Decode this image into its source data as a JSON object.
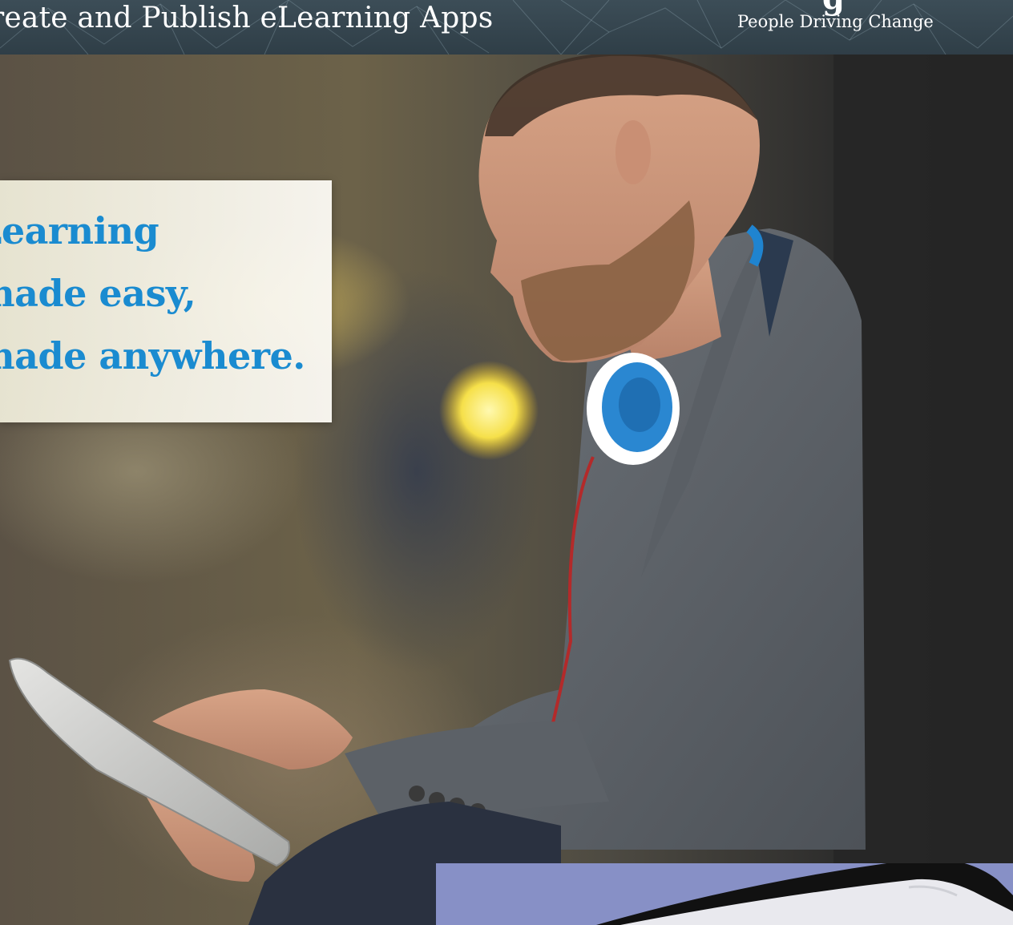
{
  "banner": {
    "title": "reate and Publish eLearning Apps",
    "brand_tagline": "People Driving Change",
    "brand_cut_glyph": "g"
  },
  "headline": {
    "line1": "Learning",
    "line2": "made easy,",
    "line3": "made anywhere."
  },
  "colors": {
    "headline_blue": "#1a8bd0",
    "banner_bg": "#34444e",
    "promo_bg": "#8790c6"
  },
  "icons": {
    "banner_background": "network-web-pattern",
    "hero": "man-with-headphones-using-tablet-photo",
    "promo": "tablet-device-corner"
  }
}
